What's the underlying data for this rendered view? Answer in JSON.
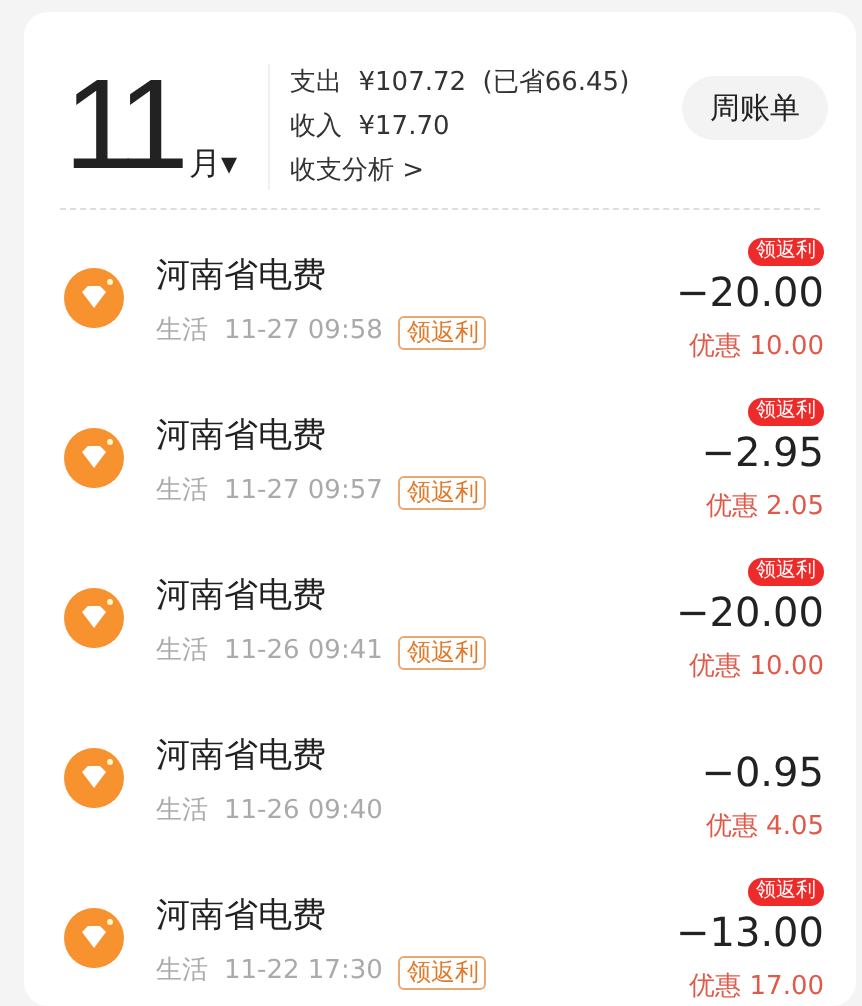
{
  "header": {
    "month": "11",
    "month_unit": "月",
    "caret": "▾",
    "expense": "支出  ¥107.72  (已省66.45)",
    "income": "收入  ¥17.70",
    "analysis": "收支分析",
    "analysis_arrow": ">",
    "weekly_button": "周账单"
  },
  "transactions": [
    {
      "name": "河南省电费",
      "category": "生活",
      "time": "11-27 09:58",
      "tag": "领返利",
      "badge": "领返利",
      "amount": "−20.00",
      "discount": "优惠 10.00"
    },
    {
      "name": "河南省电费",
      "category": "生活",
      "time": "11-27 09:57",
      "tag": "领返利",
      "badge": "领返利",
      "amount": "−2.95",
      "discount": "优惠 2.05"
    },
    {
      "name": "河南省电费",
      "category": "生活",
      "time": "11-26 09:41",
      "tag": "领返利",
      "badge": "领返利",
      "amount": "−20.00",
      "discount": "优惠 10.00"
    },
    {
      "name": "河南省电费",
      "category": "生活",
      "time": "11-26 09:40",
      "amount": "−0.95",
      "discount": "优惠 4.05"
    },
    {
      "name": "河南省电费",
      "category": "生活",
      "time": "11-22 17:30",
      "tag": "领返利",
      "badge": "领返利",
      "amount": "−13.00",
      "discount": "优惠 17.00"
    }
  ]
}
